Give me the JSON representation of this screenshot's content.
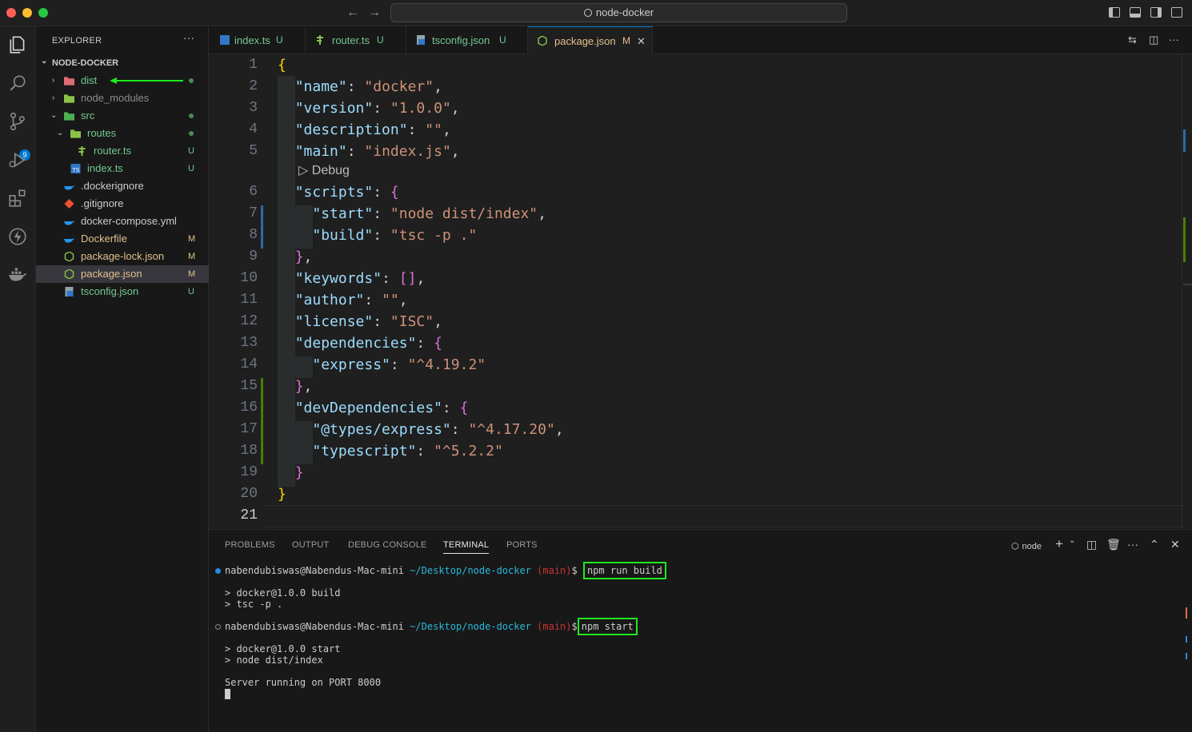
{
  "window": {
    "command_center": "node-docker"
  },
  "activity": {
    "source_control_badge": "9"
  },
  "explorer": {
    "title": "EXPLORER",
    "more": "···",
    "folder": "NODE-DOCKER",
    "items": [
      {
        "label": "dist",
        "status": ""
      },
      {
        "label": "node_modules",
        "status": ""
      },
      {
        "label": "src",
        "status": ""
      },
      {
        "label": "routes",
        "status": ""
      },
      {
        "label": "router.ts",
        "status": "U"
      },
      {
        "label": "index.ts",
        "status": "U"
      },
      {
        "label": ".dockerignore",
        "status": ""
      },
      {
        "label": ".gitignore",
        "status": ""
      },
      {
        "label": "docker-compose.yml",
        "status": ""
      },
      {
        "label": "Dockerfile",
        "status": "M"
      },
      {
        "label": "package-lock.json",
        "status": "M"
      },
      {
        "label": "package.json",
        "status": "M"
      },
      {
        "label": "tsconfig.json",
        "status": "U"
      }
    ]
  },
  "tabs": [
    {
      "label": "index.ts",
      "status": "U"
    },
    {
      "label": "router.ts",
      "status": "U"
    },
    {
      "label": "tsconfig.json",
      "status": "U"
    },
    {
      "label": "package.json",
      "status": "M"
    }
  ],
  "editor": {
    "line_numbers": [
      "1",
      "2",
      "3",
      "4",
      "5",
      "6",
      "7",
      "8",
      "9",
      "10",
      "11",
      "12",
      "13",
      "14",
      "15",
      "16",
      "17",
      "18",
      "19",
      "20",
      "21"
    ],
    "codelens": "Debug",
    "code": {
      "l1_open": "{",
      "name_key": "\"name\"",
      "name_val": "\"docker\"",
      "version_key": "\"version\"",
      "version_val": "\"1.0.0\"",
      "description_key": "\"description\"",
      "description_val": "\"\"",
      "main_key": "\"main\"",
      "main_val": "\"index.js\"",
      "scripts_key": "\"scripts\"",
      "start_key": "\"start\"",
      "start_val": "\"node dist/index\"",
      "build_key": "\"build\"",
      "build_val": "\"tsc -p .\"",
      "keywords_key": "\"keywords\"",
      "keywords_val": "[]",
      "author_key": "\"author\"",
      "author_val": "\"\"",
      "license_key": "\"license\"",
      "license_val": "\"ISC\"",
      "dependencies_key": "\"dependencies\"",
      "express_key": "\"express\"",
      "express_val": "\"^4.19.2\"",
      "devdeps_key": "\"devDependencies\"",
      "types_express_key": "\"@types/express\"",
      "types_express_val": "\"^4.17.20\"",
      "typescript_key": "\"typescript\"",
      "typescript_val": "\"^5.2.2\"",
      "l20_close": "}"
    }
  },
  "panel": {
    "tabs": [
      "PROBLEMS",
      "OUTPUT",
      "DEBUG CONSOLE",
      "TERMINAL",
      "PORTS"
    ],
    "terminal_name": "node",
    "terminal": {
      "user": "nabendubiswas@Nabendus-Mac-mini",
      "path": "~/Desktop/node-docker",
      "branch": "(main)",
      "prompt": "$",
      "cmd1": "npm run build",
      "out1a": "> docker@1.0.0 build",
      "out1b": "> tsc -p .",
      "cmd2": "npm start",
      "out2a": "> docker@1.0.0 start",
      "out2b": "> node dist/index",
      "out3": "Server running on PORT 8000"
    }
  }
}
